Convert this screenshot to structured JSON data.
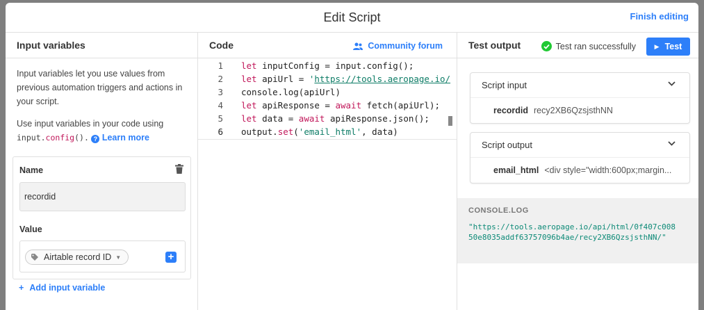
{
  "header": {
    "title": "Edit Script",
    "finish_label": "Finish editing"
  },
  "input_variables": {
    "title": "Input variables",
    "description": "Input variables let you use values from previous automation triggers and actions in your script.",
    "usage_prefix": "Use input variables in your code using",
    "usage_code_obj": "input.",
    "usage_code_fn": "config",
    "usage_code_parens": "().",
    "learn_more": "Learn more",
    "card": {
      "name_label": "Name",
      "name_value": "recordid",
      "value_label": "Value",
      "value_selected": "Airtable record ID"
    },
    "add_label": "Add input variable"
  },
  "code": {
    "title": "Code",
    "forum_label": "Community forum",
    "line_numbers": [
      "1",
      "2",
      "3",
      "4",
      "5",
      "6"
    ]
  },
  "test": {
    "title": "Test output",
    "status": "Test ran successfully",
    "button_label": "Test",
    "script_input": {
      "title": "Script input",
      "key": "recordid",
      "value": "recy2XB6QzsjsthNN"
    },
    "script_output": {
      "title": "Script output",
      "key": "email_html",
      "value": "<div style=\"width:600px;margin..."
    },
    "console_title": "CONSOLE.LOG",
    "console_text": "\"https://tools.aeropage.io/api/html/0f407c00850e8035addf63757096b4ae/recy2XB6QzsjsthNN/\""
  },
  "colors": {
    "accent": "#2d7ff9",
    "success": "#20c933",
    "string": "#0d7c66",
    "keyword": "#c1175a"
  }
}
